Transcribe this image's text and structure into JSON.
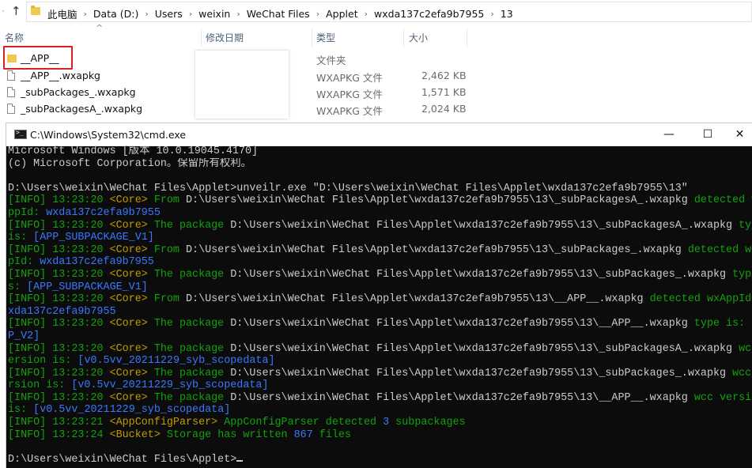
{
  "explorer": {
    "breadcrumbs": [
      "此电脑",
      "Data (D:)",
      "Users",
      "weixin",
      "WeChat Files",
      "Applet",
      "wxda137c2efa9b7955",
      "13"
    ],
    "columns": {
      "name": "名称",
      "date": "修改日期",
      "type": "类型",
      "size": "大小"
    },
    "files": [
      {
        "name": "__APP__",
        "type": "文件夹",
        "size": "",
        "icon": "folder-icon"
      },
      {
        "name": "__APP__.wxapkg",
        "type": "WXAPKG 文件",
        "size": "2,462 KB",
        "icon": "file-icon"
      },
      {
        "name": "_subPackages_.wxapkg",
        "type": "WXAPKG 文件",
        "size": "1,571 KB",
        "icon": "file-icon"
      },
      {
        "name": "_subPackagesA_.wxapkg",
        "type": "WXAPKG 文件",
        "size": "2,024 KB",
        "icon": "file-icon"
      }
    ]
  },
  "cmd": {
    "title": "C:\\Windows\\System32\\cmd.exe",
    "lines": [
      [
        [
          "w",
          "Microsoft Windows [版本 10.0.19045.4170]"
        ]
      ],
      [
        [
          "w",
          "(c) Microsoft Corporation。保留所有权利。"
        ]
      ],
      [
        [
          "w",
          ""
        ]
      ],
      [
        [
          "w",
          "D:\\Users\\weixin\\WeChat Files\\Applet>unveilr.exe \"D:\\Users\\weixin\\WeChat Files\\Applet\\wxda137c2efa9b7955\\13\""
        ]
      ],
      [
        [
          "g",
          "[INFO] 13:23:20 "
        ],
        [
          "y",
          "<Core> "
        ],
        [
          "g",
          "From "
        ],
        [
          "w",
          "D:\\Users\\weixin\\WeChat Files\\Applet\\wxda137c2efa9b7955\\13\\_subPackagesA_.wxapkg "
        ],
        [
          "g",
          "detected wxA"
        ]
      ],
      [
        [
          "g",
          "ppId: "
        ],
        [
          "b",
          "wxda137c2efa9b7955"
        ]
      ],
      [
        [
          "g",
          "[INFO] 13:23:20 "
        ],
        [
          "y",
          "<Core> "
        ],
        [
          "g",
          "The package "
        ],
        [
          "w",
          "D:\\Users\\weixin\\WeChat Files\\Applet\\wxda137c2efa9b7955\\13\\_subPackagesA_.wxapkg "
        ],
        [
          "g",
          "type"
        ]
      ],
      [
        [
          "g",
          "is: "
        ],
        [
          "b",
          "[APP_SUBPACKAGE_V1]"
        ]
      ],
      [
        [
          "g",
          "[INFO] 13:23:20 "
        ],
        [
          "y",
          "<Core> "
        ],
        [
          "g",
          "From "
        ],
        [
          "w",
          "D:\\Users\\weixin\\WeChat Files\\Applet\\wxda137c2efa9b7955\\13\\_subPackages_.wxapkg "
        ],
        [
          "g",
          "detected wxAp"
        ]
      ],
      [
        [
          "g",
          "pId: "
        ],
        [
          "b",
          "wxda137c2efa9b7955"
        ]
      ],
      [
        [
          "g",
          "[INFO] 13:23:20 "
        ],
        [
          "y",
          "<Core> "
        ],
        [
          "g",
          "The package "
        ],
        [
          "w",
          "D:\\Users\\weixin\\WeChat Files\\Applet\\wxda137c2efa9b7955\\13\\_subPackages_.wxapkg "
        ],
        [
          "g",
          "type i"
        ]
      ],
      [
        [
          "g",
          "s: "
        ],
        [
          "b",
          "[APP_SUBPACKAGE_V1]"
        ]
      ],
      [
        [
          "g",
          "[INFO] 13:23:20 "
        ],
        [
          "y",
          "<Core> "
        ],
        [
          "g",
          "From "
        ],
        [
          "w",
          "D:\\Users\\weixin\\WeChat Files\\Applet\\wxda137c2efa9b7955\\13\\__APP__.wxapkg "
        ],
        [
          "g",
          "detected wxAppId: w"
        ]
      ],
      [
        [
          "b",
          "xda137c2efa9b7955"
        ]
      ],
      [
        [
          "g",
          "[INFO] 13:23:20 "
        ],
        [
          "y",
          "<Core> "
        ],
        [
          "g",
          "The package "
        ],
        [
          "w",
          "D:\\Users\\weixin\\WeChat Files\\Applet\\wxda137c2efa9b7955\\13\\__APP__.wxapkg "
        ],
        [
          "g",
          "type is: "
        ],
        [
          "b",
          "[AP"
        ]
      ],
      [
        [
          "b",
          "P_V2]"
        ]
      ],
      [
        [
          "g",
          "[INFO] 13:23:20 "
        ],
        [
          "y",
          "<Core> "
        ],
        [
          "g",
          "The package "
        ],
        [
          "w",
          "D:\\Users\\weixin\\WeChat Files\\Applet\\wxda137c2efa9b7955\\13\\_subPackagesA_.wxapkg "
        ],
        [
          "g",
          "wcc v"
        ]
      ],
      [
        [
          "g",
          "ersion is: "
        ],
        [
          "b",
          "[v0.5vv_20211229_syb_scopedata]"
        ]
      ],
      [
        [
          "g",
          "[INFO] 13:23:20 "
        ],
        [
          "y",
          "<Core> "
        ],
        [
          "g",
          "The package "
        ],
        [
          "w",
          "D:\\Users\\weixin\\WeChat Files\\Applet\\wxda137c2efa9b7955\\13\\_subPackages_.wxapkg "
        ],
        [
          "g",
          "wcc ve"
        ]
      ],
      [
        [
          "g",
          "rsion is: "
        ],
        [
          "b",
          "[v0.5vv_20211229_syb_scopedata]"
        ]
      ],
      [
        [
          "g",
          "[INFO] 13:23:20 "
        ],
        [
          "y",
          "<Core> "
        ],
        [
          "g",
          "The package "
        ],
        [
          "w",
          "D:\\Users\\weixin\\WeChat Files\\Applet\\wxda137c2efa9b7955\\13\\__APP__.wxapkg "
        ],
        [
          "g",
          "wcc version"
        ]
      ],
      [
        [
          "g",
          "is: "
        ],
        [
          "b",
          "[v0.5vv_20211229_syb_scopedata]"
        ]
      ],
      [
        [
          "g",
          "[INFO] 13:23:21 "
        ],
        [
          "y",
          "<AppConfigParser> "
        ],
        [
          "g",
          "AppConfigParser detected "
        ],
        [
          "b",
          "3 "
        ],
        [
          "g",
          "subpackages"
        ]
      ],
      [
        [
          "g",
          "[INFO] 13:23:24 "
        ],
        [
          "y",
          "<Bucket> "
        ],
        [
          "g",
          "Storage has written "
        ],
        [
          "b",
          "867 "
        ],
        [
          "g",
          "files"
        ]
      ],
      [
        [
          "w",
          ""
        ]
      ],
      [
        [
          "w",
          "D:\\Users\\weixin\\WeChat Files\\Applet>"
        ]
      ]
    ]
  }
}
